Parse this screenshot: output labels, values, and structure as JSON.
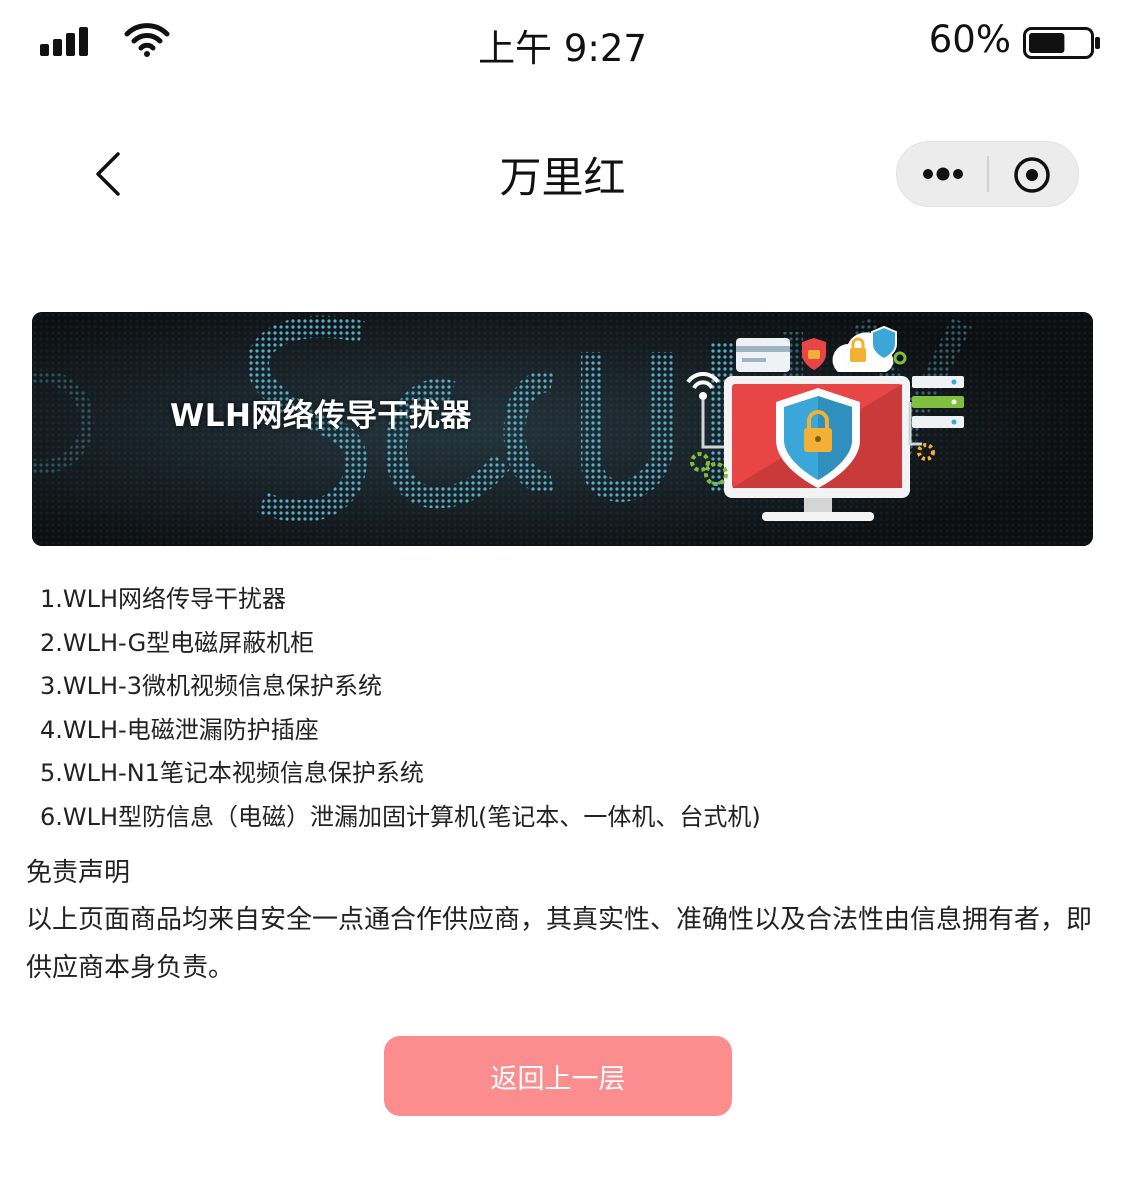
{
  "status_bar": {
    "time": "上午 9:27",
    "battery_percent": "60%",
    "battery_level": 0.6
  },
  "nav": {
    "title": "万里红",
    "back_icon": "chevron-left-icon",
    "more_icon": "more-dots-icon",
    "close_icon": "target-circle-icon"
  },
  "banner": {
    "title": "WLH网络传导干扰器",
    "background_word": "Security",
    "colors": {
      "bg": "#101214",
      "dots": "#5ec8e8",
      "monitor": "#e84646",
      "shield": "#3aa7d8",
      "lock": "#f2b134"
    }
  },
  "products": [
    "1.WLH网络传导干扰器",
    "2.WLH-G型电磁屏蔽机柜",
    "3.WLH-3微机视频信息保护系统",
    "4.WLH-电磁泄漏防护插座",
    "5.WLH-N1笔记本视频信息保护系统",
    "6.WLH型防信息（电磁）泄漏加固计算机(笔记本、一体机、台式机)"
  ],
  "disclaimer": {
    "title": "免责声明",
    "text": "以上页面商品均来自安全一点通合作供应商，其真实性、准确性以及合法性由信息拥有者，即供应商本身负责。"
  },
  "actions": {
    "back_up_label": "返回上一层",
    "back_up_color": "#fb8d8f"
  }
}
